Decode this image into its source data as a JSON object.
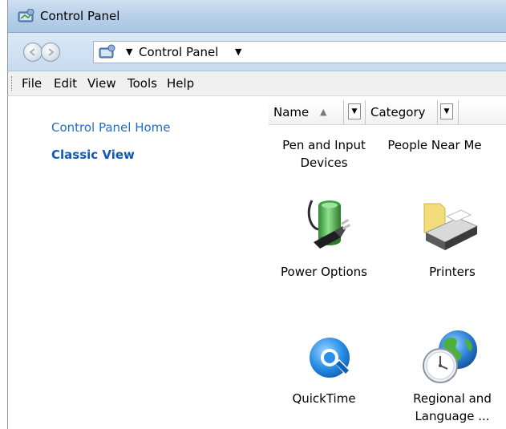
{
  "window": {
    "title": "Control Panel"
  },
  "address": {
    "location": "Control Panel"
  },
  "menu": [
    "File",
    "Edit",
    "View",
    "Tools",
    "Help"
  ],
  "sidebar": {
    "links": [
      {
        "label": "Control Panel Home"
      },
      {
        "label": "Classic View"
      }
    ]
  },
  "columns": {
    "name": "Name",
    "category": "Category"
  },
  "items": [
    {
      "label": "Pen and Input Devices",
      "icon": "pen-input-icon"
    },
    {
      "label": "People Near Me",
      "icon": "people-near-me-icon"
    },
    {
      "label": "Power Options",
      "icon": "power-options-icon"
    },
    {
      "label": "Printers",
      "icon": "printers-icon"
    },
    {
      "label": "QuickTime",
      "icon": "quicktime-icon"
    },
    {
      "label": "Regional and Language ...",
      "icon": "regional-language-icon"
    }
  ],
  "colors": {
    "link": "#1f6fc5",
    "link_bold": "#1259b5",
    "titlebar": "#b9d1ea"
  }
}
